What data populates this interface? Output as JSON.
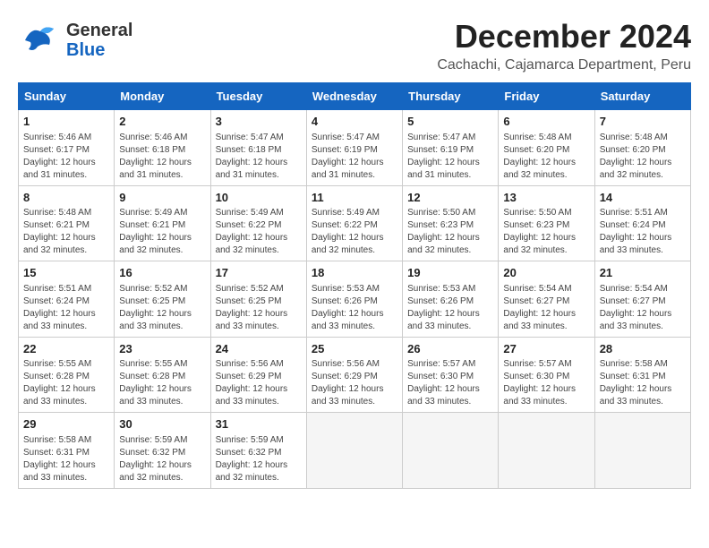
{
  "header": {
    "logo_line1": "General",
    "logo_line2": "Blue",
    "month_title": "December 2024",
    "subtitle": "Cachachi, Cajamarca Department, Peru"
  },
  "weekdays": [
    "Sunday",
    "Monday",
    "Tuesday",
    "Wednesday",
    "Thursday",
    "Friday",
    "Saturday"
  ],
  "weeks": [
    [
      {
        "day": "1",
        "info": "Sunrise: 5:46 AM\nSunset: 6:17 PM\nDaylight: 12 hours\nand 31 minutes."
      },
      {
        "day": "2",
        "info": "Sunrise: 5:46 AM\nSunset: 6:18 PM\nDaylight: 12 hours\nand 31 minutes."
      },
      {
        "day": "3",
        "info": "Sunrise: 5:47 AM\nSunset: 6:18 PM\nDaylight: 12 hours\nand 31 minutes."
      },
      {
        "day": "4",
        "info": "Sunrise: 5:47 AM\nSunset: 6:19 PM\nDaylight: 12 hours\nand 31 minutes."
      },
      {
        "day": "5",
        "info": "Sunrise: 5:47 AM\nSunset: 6:19 PM\nDaylight: 12 hours\nand 31 minutes."
      },
      {
        "day": "6",
        "info": "Sunrise: 5:48 AM\nSunset: 6:20 PM\nDaylight: 12 hours\nand 32 minutes."
      },
      {
        "day": "7",
        "info": "Sunrise: 5:48 AM\nSunset: 6:20 PM\nDaylight: 12 hours\nand 32 minutes."
      }
    ],
    [
      {
        "day": "8",
        "info": "Sunrise: 5:48 AM\nSunset: 6:21 PM\nDaylight: 12 hours\nand 32 minutes."
      },
      {
        "day": "9",
        "info": "Sunrise: 5:49 AM\nSunset: 6:21 PM\nDaylight: 12 hours\nand 32 minutes."
      },
      {
        "day": "10",
        "info": "Sunrise: 5:49 AM\nSunset: 6:22 PM\nDaylight: 12 hours\nand 32 minutes."
      },
      {
        "day": "11",
        "info": "Sunrise: 5:49 AM\nSunset: 6:22 PM\nDaylight: 12 hours\nand 32 minutes."
      },
      {
        "day": "12",
        "info": "Sunrise: 5:50 AM\nSunset: 6:23 PM\nDaylight: 12 hours\nand 32 minutes."
      },
      {
        "day": "13",
        "info": "Sunrise: 5:50 AM\nSunset: 6:23 PM\nDaylight: 12 hours\nand 32 minutes."
      },
      {
        "day": "14",
        "info": "Sunrise: 5:51 AM\nSunset: 6:24 PM\nDaylight: 12 hours\nand 33 minutes."
      }
    ],
    [
      {
        "day": "15",
        "info": "Sunrise: 5:51 AM\nSunset: 6:24 PM\nDaylight: 12 hours\nand 33 minutes."
      },
      {
        "day": "16",
        "info": "Sunrise: 5:52 AM\nSunset: 6:25 PM\nDaylight: 12 hours\nand 33 minutes."
      },
      {
        "day": "17",
        "info": "Sunrise: 5:52 AM\nSunset: 6:25 PM\nDaylight: 12 hours\nand 33 minutes."
      },
      {
        "day": "18",
        "info": "Sunrise: 5:53 AM\nSunset: 6:26 PM\nDaylight: 12 hours\nand 33 minutes."
      },
      {
        "day": "19",
        "info": "Sunrise: 5:53 AM\nSunset: 6:26 PM\nDaylight: 12 hours\nand 33 minutes."
      },
      {
        "day": "20",
        "info": "Sunrise: 5:54 AM\nSunset: 6:27 PM\nDaylight: 12 hours\nand 33 minutes."
      },
      {
        "day": "21",
        "info": "Sunrise: 5:54 AM\nSunset: 6:27 PM\nDaylight: 12 hours\nand 33 minutes."
      }
    ],
    [
      {
        "day": "22",
        "info": "Sunrise: 5:55 AM\nSunset: 6:28 PM\nDaylight: 12 hours\nand 33 minutes."
      },
      {
        "day": "23",
        "info": "Sunrise: 5:55 AM\nSunset: 6:28 PM\nDaylight: 12 hours\nand 33 minutes."
      },
      {
        "day": "24",
        "info": "Sunrise: 5:56 AM\nSunset: 6:29 PM\nDaylight: 12 hours\nand 33 minutes."
      },
      {
        "day": "25",
        "info": "Sunrise: 5:56 AM\nSunset: 6:29 PM\nDaylight: 12 hours\nand 33 minutes."
      },
      {
        "day": "26",
        "info": "Sunrise: 5:57 AM\nSunset: 6:30 PM\nDaylight: 12 hours\nand 33 minutes."
      },
      {
        "day": "27",
        "info": "Sunrise: 5:57 AM\nSunset: 6:30 PM\nDaylight: 12 hours\nand 33 minutes."
      },
      {
        "day": "28",
        "info": "Sunrise: 5:58 AM\nSunset: 6:31 PM\nDaylight: 12 hours\nand 33 minutes."
      }
    ],
    [
      {
        "day": "29",
        "info": "Sunrise: 5:58 AM\nSunset: 6:31 PM\nDaylight: 12 hours\nand 33 minutes."
      },
      {
        "day": "30",
        "info": "Sunrise: 5:59 AM\nSunset: 6:32 PM\nDaylight: 12 hours\nand 32 minutes."
      },
      {
        "day": "31",
        "info": "Sunrise: 5:59 AM\nSunset: 6:32 PM\nDaylight: 12 hours\nand 32 minutes."
      },
      {
        "day": "",
        "info": ""
      },
      {
        "day": "",
        "info": ""
      },
      {
        "day": "",
        "info": ""
      },
      {
        "day": "",
        "info": ""
      }
    ]
  ]
}
